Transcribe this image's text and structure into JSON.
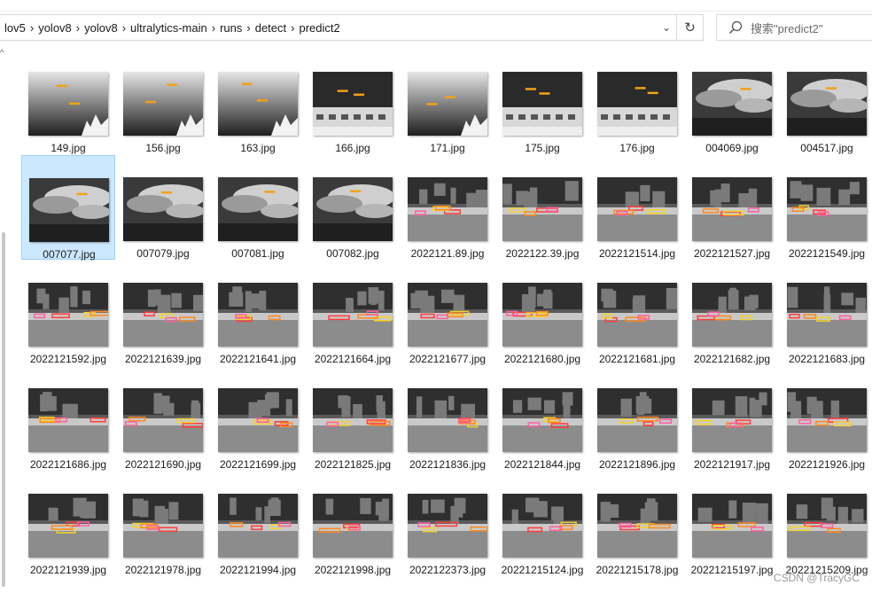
{
  "address_bar": {
    "breadcrumbs": [
      "lov5",
      "yolov8",
      "yolov8",
      "ultralytics-main",
      "runs",
      "detect",
      "predict2"
    ]
  },
  "search": {
    "placeholder": "搜索\"predict2\""
  },
  "watermark": "CSDN @TracyGC",
  "files": [
    {
      "name": "149.jpg",
      "scene": "sky"
    },
    {
      "name": "156.jpg",
      "scene": "sky"
    },
    {
      "name": "163.jpg",
      "scene": "sky"
    },
    {
      "name": "166.jpg",
      "scene": "building-sky"
    },
    {
      "name": "171.jpg",
      "scene": "sky"
    },
    {
      "name": "175.jpg",
      "scene": "building-sky"
    },
    {
      "name": "176.jpg",
      "scene": "building-sky"
    },
    {
      "name": "004069.jpg",
      "scene": "clouds"
    },
    {
      "name": "004517.jpg",
      "scene": "clouds"
    },
    {
      "name": "007077.jpg",
      "scene": "clouds",
      "selected": true
    },
    {
      "name": "007079.jpg",
      "scene": "clouds"
    },
    {
      "name": "007081.jpg",
      "scene": "clouds"
    },
    {
      "name": "007082.jpg",
      "scene": "clouds"
    },
    {
      "name": "2022121.89.jpg",
      "scene": "street"
    },
    {
      "name": "2022122.39.jpg",
      "scene": "street"
    },
    {
      "name": "2022121514.jpg",
      "scene": "street"
    },
    {
      "name": "2022121527.jpg",
      "scene": "street"
    },
    {
      "name": "2022121549.jpg",
      "scene": "street"
    },
    {
      "name": "2022121592.jpg",
      "scene": "street"
    },
    {
      "name": "2022121639.jpg",
      "scene": "street"
    },
    {
      "name": "2022121641.jpg",
      "scene": "street"
    },
    {
      "name": "2022121664.jpg",
      "scene": "street"
    },
    {
      "name": "2022121677.jpg",
      "scene": "street"
    },
    {
      "name": "2022121680.jpg",
      "scene": "street"
    },
    {
      "name": "2022121681.jpg",
      "scene": "street"
    },
    {
      "name": "2022121682.jpg",
      "scene": "street"
    },
    {
      "name": "2022121683.jpg",
      "scene": "street"
    },
    {
      "name": "2022121686.jpg",
      "scene": "street"
    },
    {
      "name": "2022121690.jpg",
      "scene": "street"
    },
    {
      "name": "2022121699.jpg",
      "scene": "street"
    },
    {
      "name": "2022121825.jpg",
      "scene": "street"
    },
    {
      "name": "2022121836.jpg",
      "scene": "street"
    },
    {
      "name": "2022121844.jpg",
      "scene": "street"
    },
    {
      "name": "2022121896.jpg",
      "scene": "street"
    },
    {
      "name": "2022121917.jpg",
      "scene": "street"
    },
    {
      "name": "2022121926.jpg",
      "scene": "street"
    },
    {
      "name": "2022121939.jpg",
      "scene": "street"
    },
    {
      "name": "2022121978.jpg",
      "scene": "street"
    },
    {
      "name": "2022121994.jpg",
      "scene": "street"
    },
    {
      "name": "2022121998.jpg",
      "scene": "street"
    },
    {
      "name": "2022122373.jpg",
      "scene": "street"
    },
    {
      "name": "20221215124.jpg",
      "scene": "street"
    },
    {
      "name": "20221215178.jpg",
      "scene": "street"
    },
    {
      "name": "20221215197.jpg",
      "scene": "street"
    },
    {
      "name": "20221215209.jpg",
      "scene": "street"
    }
  ]
}
